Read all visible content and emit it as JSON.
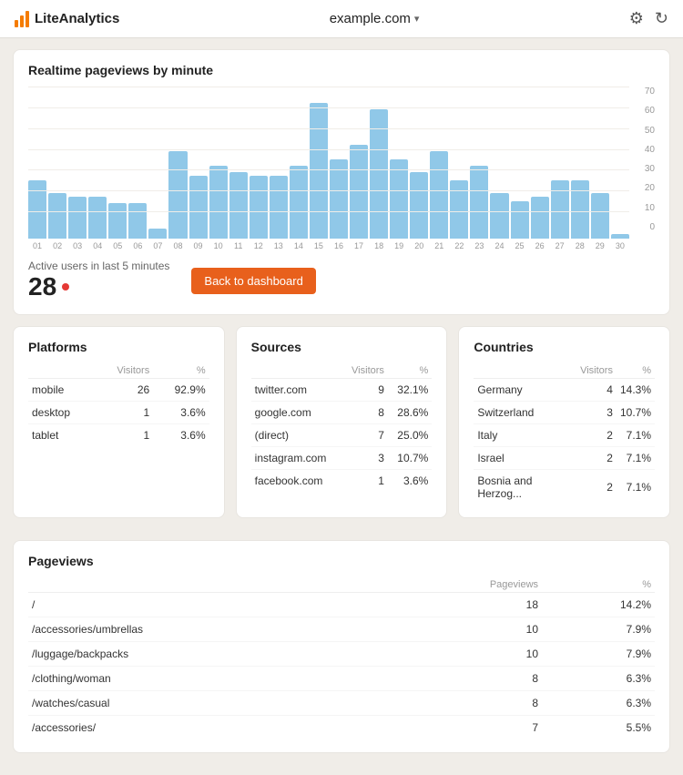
{
  "header": {
    "logo_text": "LiteAnalytics",
    "site_name": "example.com",
    "settings_icon": "⚙",
    "refresh_icon": "↻"
  },
  "realtime": {
    "title": "Realtime pageviews by minute",
    "active_users_label": "Active users in last 5 minutes",
    "active_users_count": "28",
    "back_btn": "Back to dashboard",
    "y_axis": [
      "70",
      "60",
      "50",
      "40",
      "30",
      "20",
      "10",
      "0"
    ],
    "bars": [
      {
        "label": "01",
        "value": 28
      },
      {
        "label": "02",
        "value": 22
      },
      {
        "label": "03",
        "value": 20
      },
      {
        "label": "04",
        "value": 20
      },
      {
        "label": "05",
        "value": 17
      },
      {
        "label": "06",
        "value": 17
      },
      {
        "label": "07",
        "value": 5
      },
      {
        "label": "08",
        "value": 42
      },
      {
        "label": "09",
        "value": 30
      },
      {
        "label": "10",
        "value": 35
      },
      {
        "label": "11",
        "value": 32
      },
      {
        "label": "12",
        "value": 30
      },
      {
        "label": "13",
        "value": 30
      },
      {
        "label": "14",
        "value": 35
      },
      {
        "label": "15",
        "value": 65
      },
      {
        "label": "16",
        "value": 38
      },
      {
        "label": "17",
        "value": 45
      },
      {
        "label": "18",
        "value": 62
      },
      {
        "label": "19",
        "value": 38
      },
      {
        "label": "20",
        "value": 32
      },
      {
        "label": "21",
        "value": 42
      },
      {
        "label": "22",
        "value": 28
      },
      {
        "label": "23",
        "value": 35
      },
      {
        "label": "24",
        "value": 22
      },
      {
        "label": "25",
        "value": 18
      },
      {
        "label": "26",
        "value": 20
      },
      {
        "label": "27",
        "value": 28
      },
      {
        "label": "28",
        "value": 28
      },
      {
        "label": "29",
        "value": 22
      },
      {
        "label": "30",
        "value": 2
      }
    ],
    "max_value": 70
  },
  "platforms": {
    "title": "Platforms",
    "col_visitors": "Visitors",
    "col_pct": "%",
    "rows": [
      {
        "name": "mobile",
        "visitors": "26",
        "pct": "92.9%"
      },
      {
        "name": "desktop",
        "visitors": "1",
        "pct": "3.6%"
      },
      {
        "name": "tablet",
        "visitors": "1",
        "pct": "3.6%"
      }
    ]
  },
  "sources": {
    "title": "Sources",
    "col_visitors": "Visitors",
    "col_pct": "%",
    "rows": [
      {
        "name": "twitter.com",
        "visitors": "9",
        "pct": "32.1%"
      },
      {
        "name": "google.com",
        "visitors": "8",
        "pct": "28.6%"
      },
      {
        "name": "(direct)",
        "visitors": "7",
        "pct": "25.0%"
      },
      {
        "name": "instagram.com",
        "visitors": "3",
        "pct": "10.7%"
      },
      {
        "name": "facebook.com",
        "visitors": "1",
        "pct": "3.6%"
      }
    ]
  },
  "countries": {
    "title": "Countries",
    "col_visitors": "Visitors",
    "col_pct": "%",
    "rows": [
      {
        "name": "Germany",
        "visitors": "4",
        "pct": "14.3%"
      },
      {
        "name": "Switzerland",
        "visitors": "3",
        "pct": "10.7%"
      },
      {
        "name": "Italy",
        "visitors": "2",
        "pct": "7.1%"
      },
      {
        "name": "Israel",
        "visitors": "2",
        "pct": "7.1%"
      },
      {
        "name": "Bosnia and Herzog...",
        "visitors": "2",
        "pct": "7.1%"
      }
    ]
  },
  "pageviews": {
    "title": "Pageviews",
    "col_pageviews": "Pageviews",
    "col_pct": "%",
    "rows": [
      {
        "path": "/",
        "pageviews": "18",
        "pct": "14.2%"
      },
      {
        "path": "/accessories/umbrellas",
        "pageviews": "10",
        "pct": "7.9%"
      },
      {
        "path": "/luggage/backpacks",
        "pageviews": "10",
        "pct": "7.9%"
      },
      {
        "path": "/clothing/woman",
        "pageviews": "8",
        "pct": "6.3%"
      },
      {
        "path": "/watches/casual",
        "pageviews": "8",
        "pct": "6.3%"
      },
      {
        "path": "/accessories/",
        "pageviews": "7",
        "pct": "5.5%"
      }
    ]
  }
}
